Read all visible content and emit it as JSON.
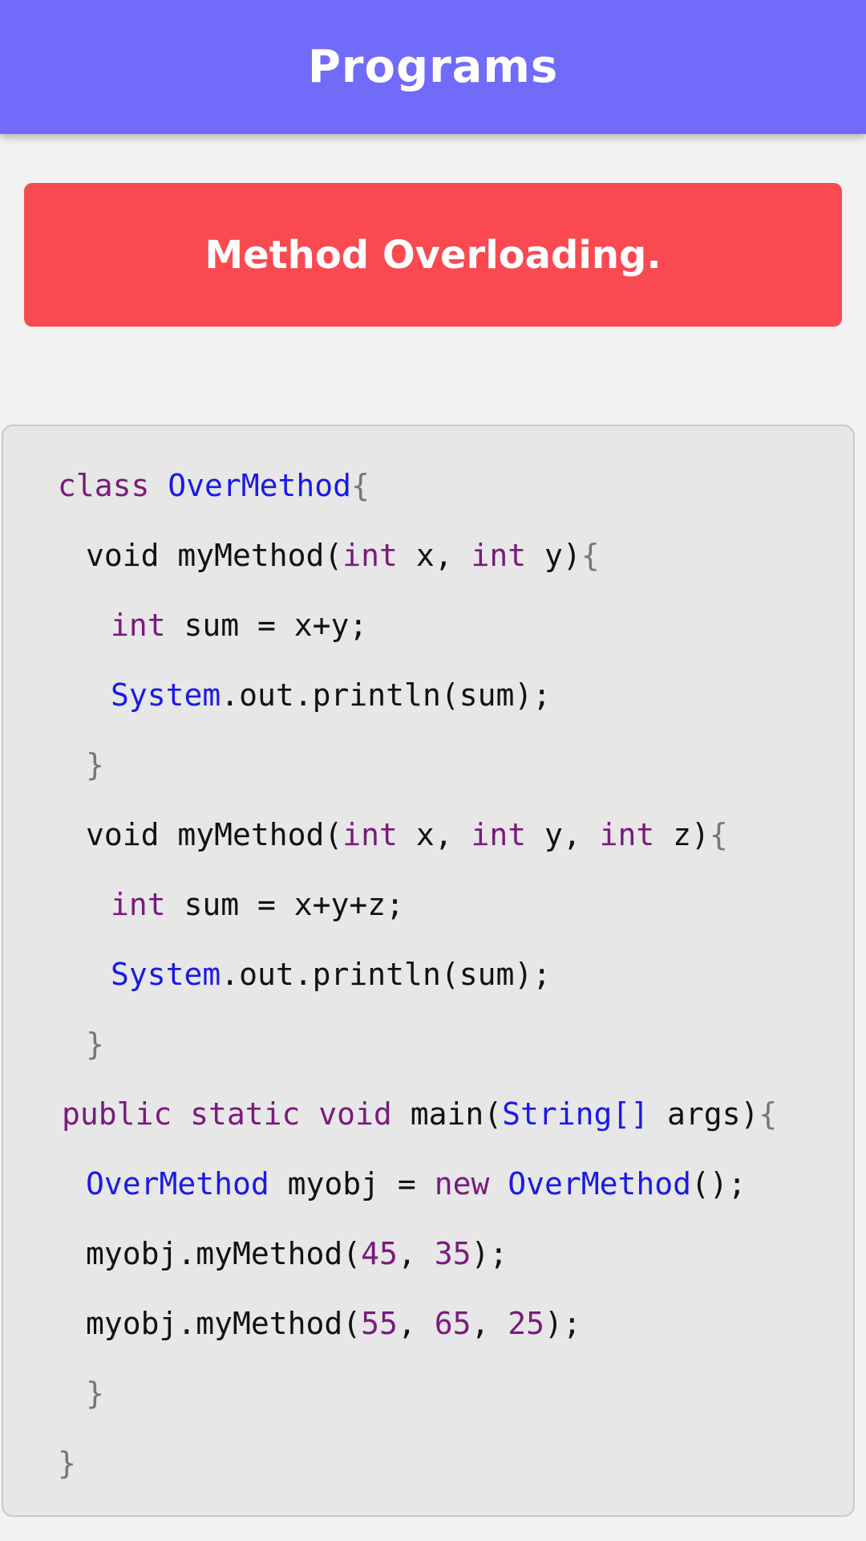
{
  "app_bar": {
    "title": "Programs",
    "color": "#716bfa"
  },
  "title_card": {
    "text": "Method Overloading.",
    "color": "#f94a51"
  },
  "code": {
    "lines": [
      [
        {
          "t": "class",
          "c": "kw"
        },
        {
          "t": " "
        },
        {
          "t": "OverMethod",
          "c": "ty"
        },
        {
          "t": "{",
          "c": "br"
        }
      ],
      [
        {
          "t": "void myMethod("
        },
        {
          "t": "int",
          "c": "kw"
        },
        {
          "t": " x, "
        },
        {
          "t": "int",
          "c": "kw"
        },
        {
          "t": " y)"
        },
        {
          "t": "{",
          "c": "br"
        }
      ],
      [
        {
          "t": "int",
          "c": "kw"
        },
        {
          "t": " sum = x+y;"
        }
      ],
      [
        {
          "t": "System",
          "c": "ty"
        },
        {
          "t": ".out.println(sum);"
        }
      ],
      [
        {
          "t": "}",
          "c": "br"
        }
      ],
      [
        {
          "t": "void myMethod("
        },
        {
          "t": "int",
          "c": "kw"
        },
        {
          "t": " x, "
        },
        {
          "t": "int",
          "c": "kw"
        },
        {
          "t": " y, "
        },
        {
          "t": "int",
          "c": "kw"
        },
        {
          "t": " z)"
        },
        {
          "t": "{",
          "c": "br"
        }
      ],
      [
        {
          "t": "int",
          "c": "kw"
        },
        {
          "t": " sum = x+y+z;"
        }
      ],
      [
        {
          "t": "System",
          "c": "ty"
        },
        {
          "t": ".out.println(sum);"
        }
      ],
      [
        {
          "t": "}",
          "c": "br"
        }
      ],
      [
        {
          "t": "public static void",
          "c": "kw"
        },
        {
          "t": " main("
        },
        {
          "t": "String[]",
          "c": "ty"
        },
        {
          "t": " args)"
        },
        {
          "t": "{",
          "c": "br"
        }
      ],
      [
        {
          "t": "OverMethod",
          "c": "ty"
        },
        {
          "t": " myobj = "
        },
        {
          "t": "new",
          "c": "kw"
        },
        {
          "t": " "
        },
        {
          "t": "OverMethod",
          "c": "ty"
        },
        {
          "t": "();"
        }
      ],
      [
        {
          "t": "myobj.myMethod("
        },
        {
          "t": "45",
          "c": "num"
        },
        {
          "t": ", "
        },
        {
          "t": "35",
          "c": "num"
        },
        {
          "t": ");"
        }
      ],
      [
        {
          "t": "myobj.myMethod("
        },
        {
          "t": "55",
          "c": "num"
        },
        {
          "t": ", "
        },
        {
          "t": "65",
          "c": "num"
        },
        {
          "t": ", "
        },
        {
          "t": "25",
          "c": "num"
        },
        {
          "t": ");"
        }
      ],
      [
        {
          "t": "}",
          "c": "br"
        }
      ],
      [
        {
          "t": "}",
          "c": "br"
        }
      ]
    ]
  }
}
